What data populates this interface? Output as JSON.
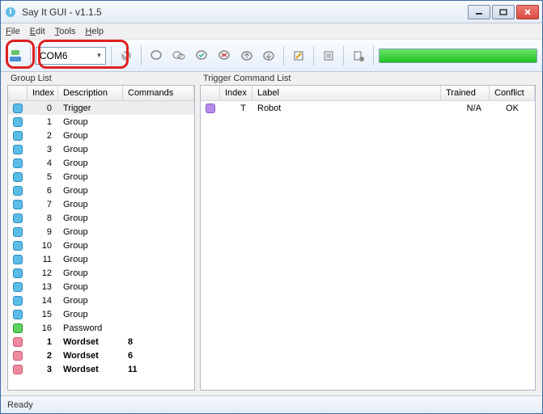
{
  "window": {
    "title": "Say It GUI - v1.1.5"
  },
  "menu": [
    "File",
    "Edit",
    "Tools",
    "Help"
  ],
  "toolbar": {
    "port": "COM6"
  },
  "panels": {
    "group_title": "Group List",
    "trigger_title": "Trigger Command List"
  },
  "group_cols": [
    "Index",
    "Description",
    "Commands"
  ],
  "trigger_cols": [
    "Index",
    "Label",
    "Trained",
    "Conflict"
  ],
  "groups": [
    {
      "icon": "blue",
      "index": "0",
      "desc": "Trigger",
      "cmds": "",
      "selected": true,
      "bold": false
    },
    {
      "icon": "blue",
      "index": "1",
      "desc": "Group",
      "cmds": "",
      "selected": false,
      "bold": false
    },
    {
      "icon": "blue",
      "index": "2",
      "desc": "Group",
      "cmds": "",
      "selected": false,
      "bold": false
    },
    {
      "icon": "blue",
      "index": "3",
      "desc": "Group",
      "cmds": "",
      "selected": false,
      "bold": false
    },
    {
      "icon": "blue",
      "index": "4",
      "desc": "Group",
      "cmds": "",
      "selected": false,
      "bold": false
    },
    {
      "icon": "blue",
      "index": "5",
      "desc": "Group",
      "cmds": "",
      "selected": false,
      "bold": false
    },
    {
      "icon": "blue",
      "index": "6",
      "desc": "Group",
      "cmds": "",
      "selected": false,
      "bold": false
    },
    {
      "icon": "blue",
      "index": "7",
      "desc": "Group",
      "cmds": "",
      "selected": false,
      "bold": false
    },
    {
      "icon": "blue",
      "index": "8",
      "desc": "Group",
      "cmds": "",
      "selected": false,
      "bold": false
    },
    {
      "icon": "blue",
      "index": "9",
      "desc": "Group",
      "cmds": "",
      "selected": false,
      "bold": false
    },
    {
      "icon": "blue",
      "index": "10",
      "desc": "Group",
      "cmds": "",
      "selected": false,
      "bold": false
    },
    {
      "icon": "blue",
      "index": "11",
      "desc": "Group",
      "cmds": "",
      "selected": false,
      "bold": false
    },
    {
      "icon": "blue",
      "index": "12",
      "desc": "Group",
      "cmds": "",
      "selected": false,
      "bold": false
    },
    {
      "icon": "blue",
      "index": "13",
      "desc": "Group",
      "cmds": "",
      "selected": false,
      "bold": false
    },
    {
      "icon": "blue",
      "index": "14",
      "desc": "Group",
      "cmds": "",
      "selected": false,
      "bold": false
    },
    {
      "icon": "blue",
      "index": "15",
      "desc": "Group",
      "cmds": "",
      "selected": false,
      "bold": false
    },
    {
      "icon": "green",
      "index": "16",
      "desc": "Password",
      "cmds": "",
      "selected": false,
      "bold": false
    },
    {
      "icon": "pink",
      "index": "1",
      "desc": "Wordset",
      "cmds": "8",
      "selected": false,
      "bold": true
    },
    {
      "icon": "pink",
      "index": "2",
      "desc": "Wordset",
      "cmds": "6",
      "selected": false,
      "bold": true
    },
    {
      "icon": "pink",
      "index": "3",
      "desc": "Wordset",
      "cmds": "11",
      "selected": false,
      "bold": true
    }
  ],
  "triggers": [
    {
      "icon": "purple",
      "index": "T",
      "label": "Robot",
      "trained": "N/A",
      "conflict": "OK"
    }
  ],
  "status": "Ready"
}
